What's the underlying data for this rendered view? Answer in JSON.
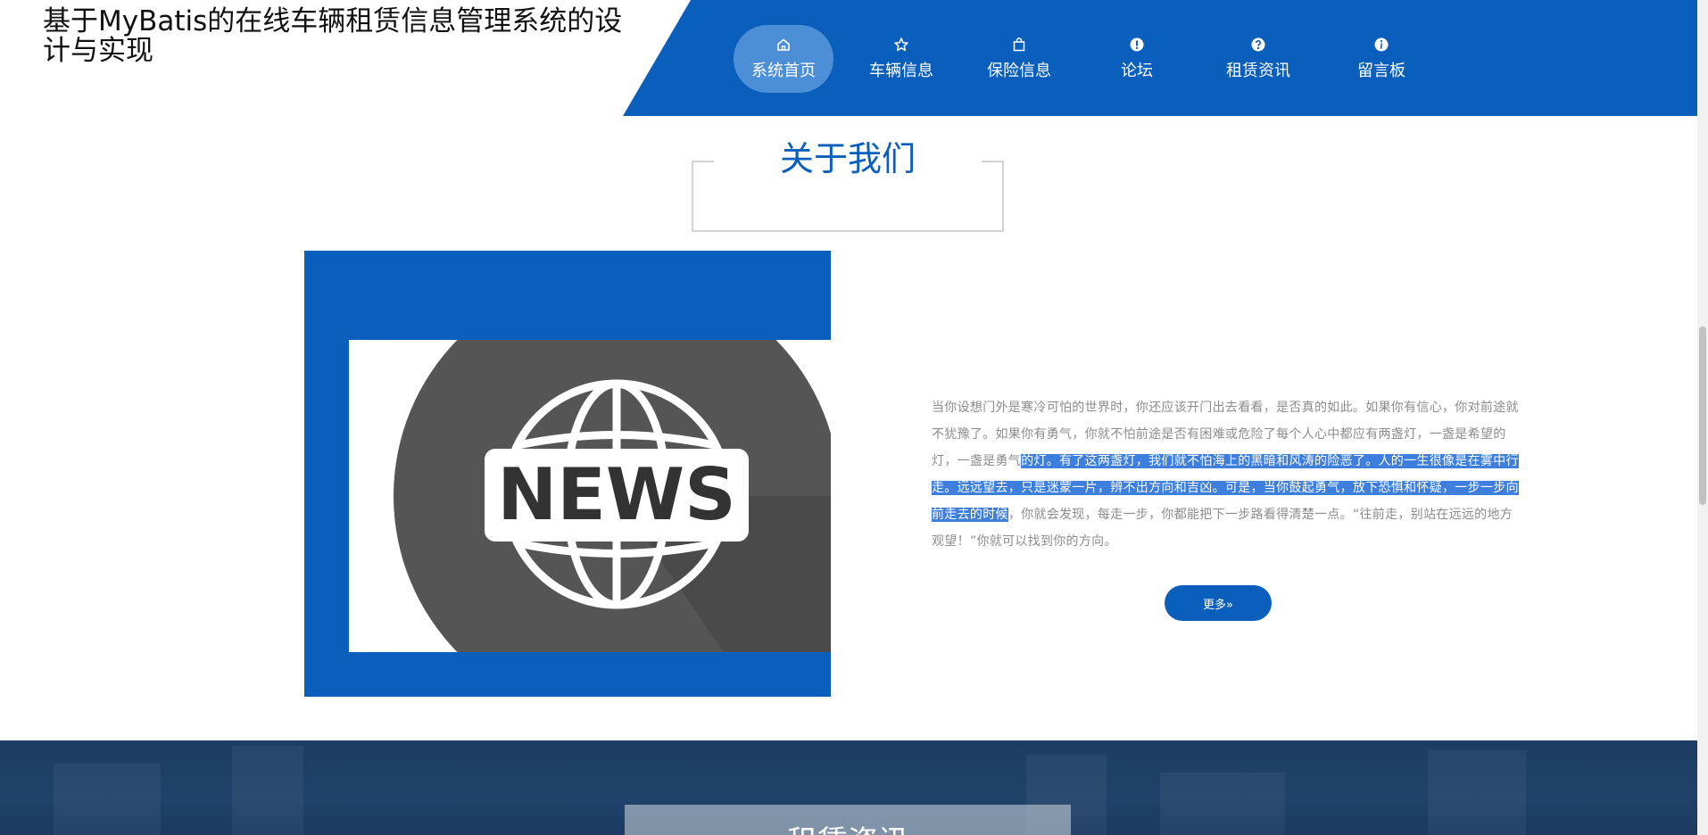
{
  "header": {
    "site_title": "基于MyBatis的在线车辆租赁信息管理系统的设计与实现"
  },
  "nav": {
    "items": [
      {
        "label": "系统首页",
        "icon": "home-icon"
      },
      {
        "label": "车辆信息",
        "icon": "star-icon"
      },
      {
        "label": "保险信息",
        "icon": "bag-icon"
      },
      {
        "label": "论坛",
        "icon": "alert-icon"
      },
      {
        "label": "租赁资讯",
        "icon": "question-icon"
      },
      {
        "label": "留言板",
        "icon": "info-icon"
      }
    ],
    "active_index": 0
  },
  "about": {
    "title": "关于我们",
    "image_label": "NEWS",
    "text_part1": "当你设想门外是寒冷可怕的世界时，你还应该开门出去看看，是否真的如此。如果你有信心，你对前途就不犹豫了。如果你有勇气，你就不怕前途是否有困难或危险了每个人心中都应有两盏灯，一盏是希望的灯，一盏是勇气",
    "text_highlight": "的灯。有了这两盏灯，我们就不怕海上的黑暗和风涛的险恶了。人的一生很像是在雾中行走。远远望去，只是迷蒙一片，辨不出方向和吉凶。可是，当你鼓起勇气，放下恐惧和怀疑，一步一步向前走去的时候",
    "text_part2": "，你就会发现，每走一步，你都能把下一步路看得清楚一点。“往前走，别站在远远的地方观望！”你就可以找到你的方向。",
    "more_label": "更多»"
  },
  "news_section": {
    "title": "租赁资讯"
  },
  "colors": {
    "brand_blue": "#0a5fbd",
    "nav_active": "#4c8fd6",
    "text_gray": "#8c8c8c",
    "selection": "#3e7fdd",
    "bottom_band": "#1f4068"
  }
}
